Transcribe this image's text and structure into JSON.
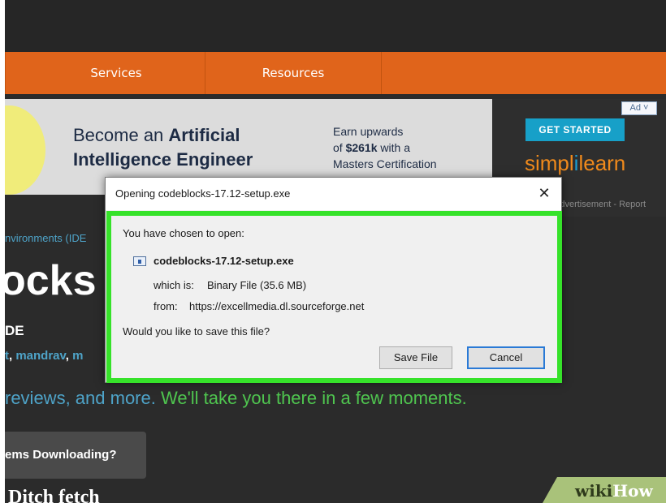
{
  "nav": {
    "items": [
      {
        "label": "Services"
      },
      {
        "label": "Resources"
      }
    ]
  },
  "ad": {
    "headline_plain": "Become an ",
    "headline_bold": "Artificial Intelligence Engineer",
    "earn_line1": "Earn upwards",
    "earn_line2_plain": "of ",
    "earn_line2_bold": "$261k",
    "earn_line2_rest": " with a",
    "earn_line3": "Masters Certification",
    "badge": "Ad ˅",
    "cta": "GET STARTED",
    "brand_a": "simpl",
    "brand_b": "i",
    "brand_c": "learn",
    "report": "Advertisement - Report"
  },
  "page": {
    "breadcrumb": "nvironments (IDE",
    "title": "ocks",
    "subtitle": "DE",
    "author_1": "t",
    "author_2": "mandrav",
    "author_3": "m",
    "tagline_blue": "reviews, and more.",
    "tagline_green": "We'll take you there in a few moments.",
    "problems_button": "ems Downloading?",
    "bottom_text": "Ditch fetch"
  },
  "dialog": {
    "title": "Opening codeblocks-17.12-setup.exe",
    "close": "✕",
    "chosen_label": "You have chosen to open:",
    "filename": "codeblocks-17.12-setup.exe",
    "which_is_label": "which is:",
    "which_is_value": "Binary File (35.6 MB)",
    "from_label": "from:",
    "from_value": "https://excellmedia.dl.sourceforge.net",
    "question": "Would you like to save this file?",
    "save_button": "Save File",
    "cancel_button": "Cancel"
  },
  "watermark": {
    "wiki": "wiki",
    "how": "How"
  },
  "colors": {
    "nav": "#e0641b",
    "highlight": "#36e22a",
    "link": "#4ea3c8",
    "green_text": "#4fc54f"
  }
}
